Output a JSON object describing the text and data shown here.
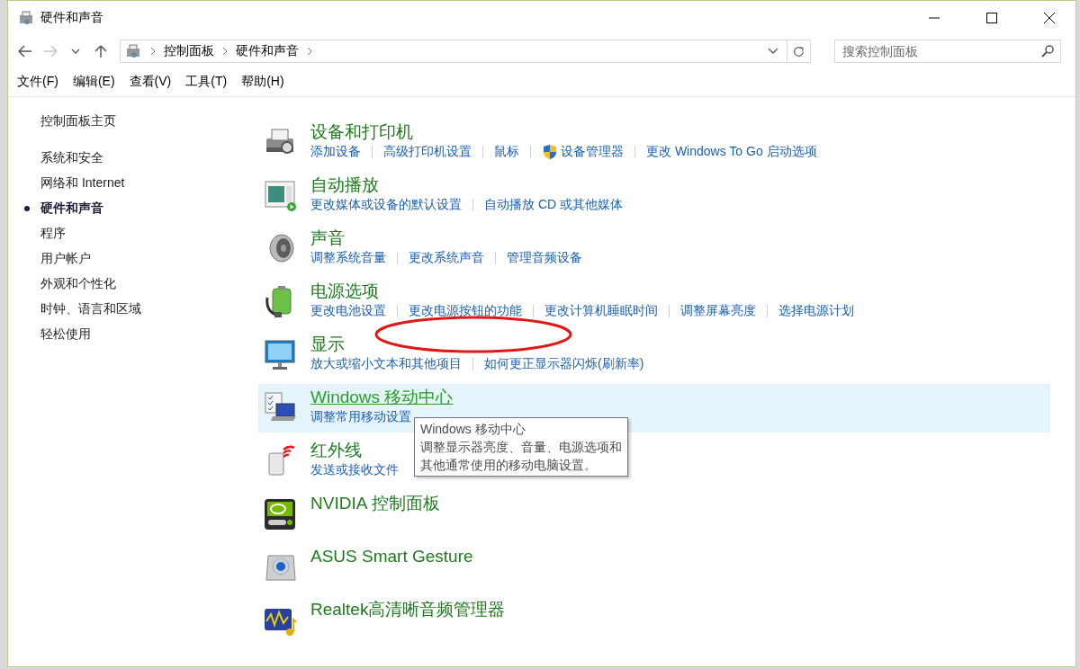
{
  "window": {
    "title": "硬件和声音"
  },
  "address_bar": {
    "crumbs": [
      "控制面板",
      "硬件和声音"
    ]
  },
  "search": {
    "placeholder": "搜索控制面板"
  },
  "menu_bar": [
    "文件(F)",
    "编辑(E)",
    "查看(V)",
    "工具(T)",
    "帮助(H)"
  ],
  "sidebar": {
    "home": "控制面板主页",
    "items": [
      {
        "label": "系统和安全",
        "selected": false
      },
      {
        "label": "网络和 Internet",
        "selected": false
      },
      {
        "label": "硬件和声音",
        "selected": true
      },
      {
        "label": "程序",
        "selected": false
      },
      {
        "label": "用户帐户",
        "selected": false
      },
      {
        "label": "外观和个性化",
        "selected": false
      },
      {
        "label": "时钟、语言和区域",
        "selected": false
      },
      {
        "label": "轻松使用",
        "selected": false
      }
    ]
  },
  "categories": [
    {
      "title": "设备和打印机",
      "hovered": false,
      "links": [
        {
          "label": "添加设备"
        },
        {
          "label": "高级打印机设置"
        },
        {
          "label": "鼠标"
        },
        {
          "label": "设备管理器",
          "shield": true
        },
        {
          "label": "更改 Windows To Go 启动选项"
        }
      ]
    },
    {
      "title": "自动播放",
      "hovered": false,
      "links": [
        {
          "label": "更改媒体或设备的默认设置"
        },
        {
          "label": "自动播放 CD 或其他媒体"
        }
      ]
    },
    {
      "title": "声音",
      "hovered": false,
      "links": [
        {
          "label": "调整系统音量"
        },
        {
          "label": "更改系统声音"
        },
        {
          "label": "管理音频设备"
        }
      ]
    },
    {
      "title": "电源选项",
      "hovered": false,
      "links": [
        {
          "label": "更改电池设置"
        },
        {
          "label": "更改电源按钮的功能"
        },
        {
          "label": "更改计算机睡眠时间"
        },
        {
          "label": "调整屏幕亮度"
        },
        {
          "label": "选择电源计划"
        }
      ]
    },
    {
      "title": "显示",
      "hovered": false,
      "links": [
        {
          "label": "放大或缩小文本和其他项目"
        },
        {
          "label": "如何更正显示器闪烁(刷新率)"
        }
      ]
    },
    {
      "title": "Windows 移动中心",
      "hovered": true,
      "links": [
        {
          "label": "调整常用移动设置"
        }
      ],
      "tooltip": {
        "title": "Windows 移动中心",
        "text": [
          "调整显示器亮度、音量、电源选项和",
          "其他通常使用的移动电脑设置。"
        ]
      }
    },
    {
      "title": "红外线",
      "hovered": false,
      "links": [
        {
          "label": "发送或接收文件"
        }
      ]
    },
    {
      "title": "NVIDIA 控制面板",
      "hovered": false
    },
    {
      "title": "ASUS Smart Gesture",
      "hovered": false
    },
    {
      "title": "Realtek高清晰音频管理器",
      "hovered": false
    }
  ],
  "annotation": {
    "kind": "ellipse"
  }
}
